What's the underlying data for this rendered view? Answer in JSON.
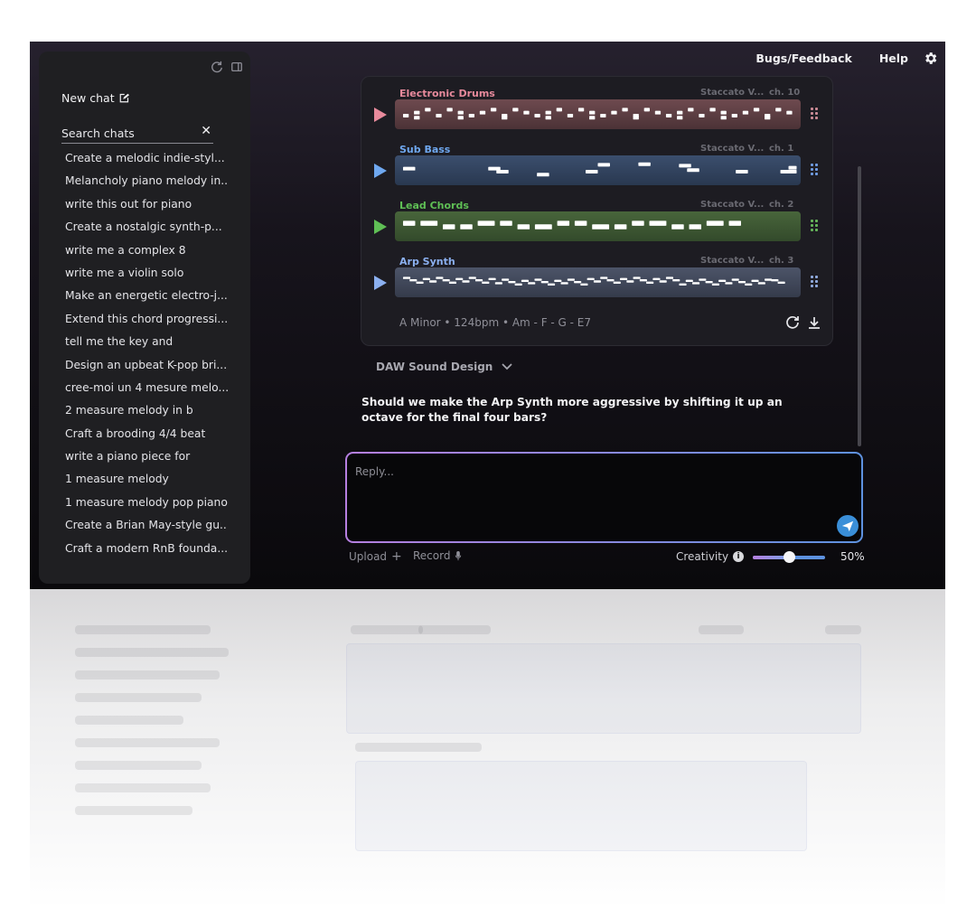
{
  "colors": {
    "electronic_drums": "#e88a9c",
    "sub_bass": "#6fa8f0",
    "lead_chords": "#5fbf55",
    "arp_synth": "#8bb0f0"
  },
  "sidebar": {
    "new_chat_label": "New chat",
    "search_placeholder": "Search chats",
    "chats": [
      "Create a melodic indie-styl...",
      "Melancholy piano melody in...",
      "write this out for piano",
      "Create a nostalgic synth-p...",
      "write me a complex 8",
      "write me a violin solo",
      "Make an energetic electro-j...",
      "Extend this chord progressi...",
      "tell me the key and",
      "Design an upbeat K-pop bri...",
      "cree-moi un 4 mesure melo...",
      "2 measure melody in b",
      "Craft a brooding 4/4 beat",
      "write a piano piece for",
      "1 measure melody",
      "1 measure melody pop piano",
      "Create a Brian May-style gu...",
      "Craft a modern RnB founda..."
    ]
  },
  "header": {
    "bugs_feedback": "Bugs/Feedback",
    "help": "Help"
  },
  "tracks": [
    {
      "name": "Electronic Drums",
      "instrument": "Staccato V...",
      "channel": "ch. 10",
      "color_key": "electronic_drums"
    },
    {
      "name": "Sub Bass",
      "instrument": "Staccato V...",
      "channel": "ch. 1",
      "color_key": "sub_bass"
    },
    {
      "name": "Lead Chords",
      "instrument": "Staccato V...",
      "channel": "ch. 2",
      "color_key": "lead_chords"
    },
    {
      "name": "Arp Synth",
      "instrument": "Staccato V...",
      "channel": "ch. 3",
      "color_key": "arp_synth"
    }
  ],
  "card_footer": "A Minor • 124bpm • Am - F - G - E7",
  "sound_design_label": "DAW Sound Design",
  "question": "Should we make the Arp Synth more aggressive by shifting it up an octave for the final four bars?",
  "reply": {
    "placeholder": "Reply..."
  },
  "controls": {
    "upload_label": "Upload",
    "record_label": "Record",
    "creativity_label": "Creativity",
    "creativity_value": "50%",
    "creativity_level": 0.5
  }
}
